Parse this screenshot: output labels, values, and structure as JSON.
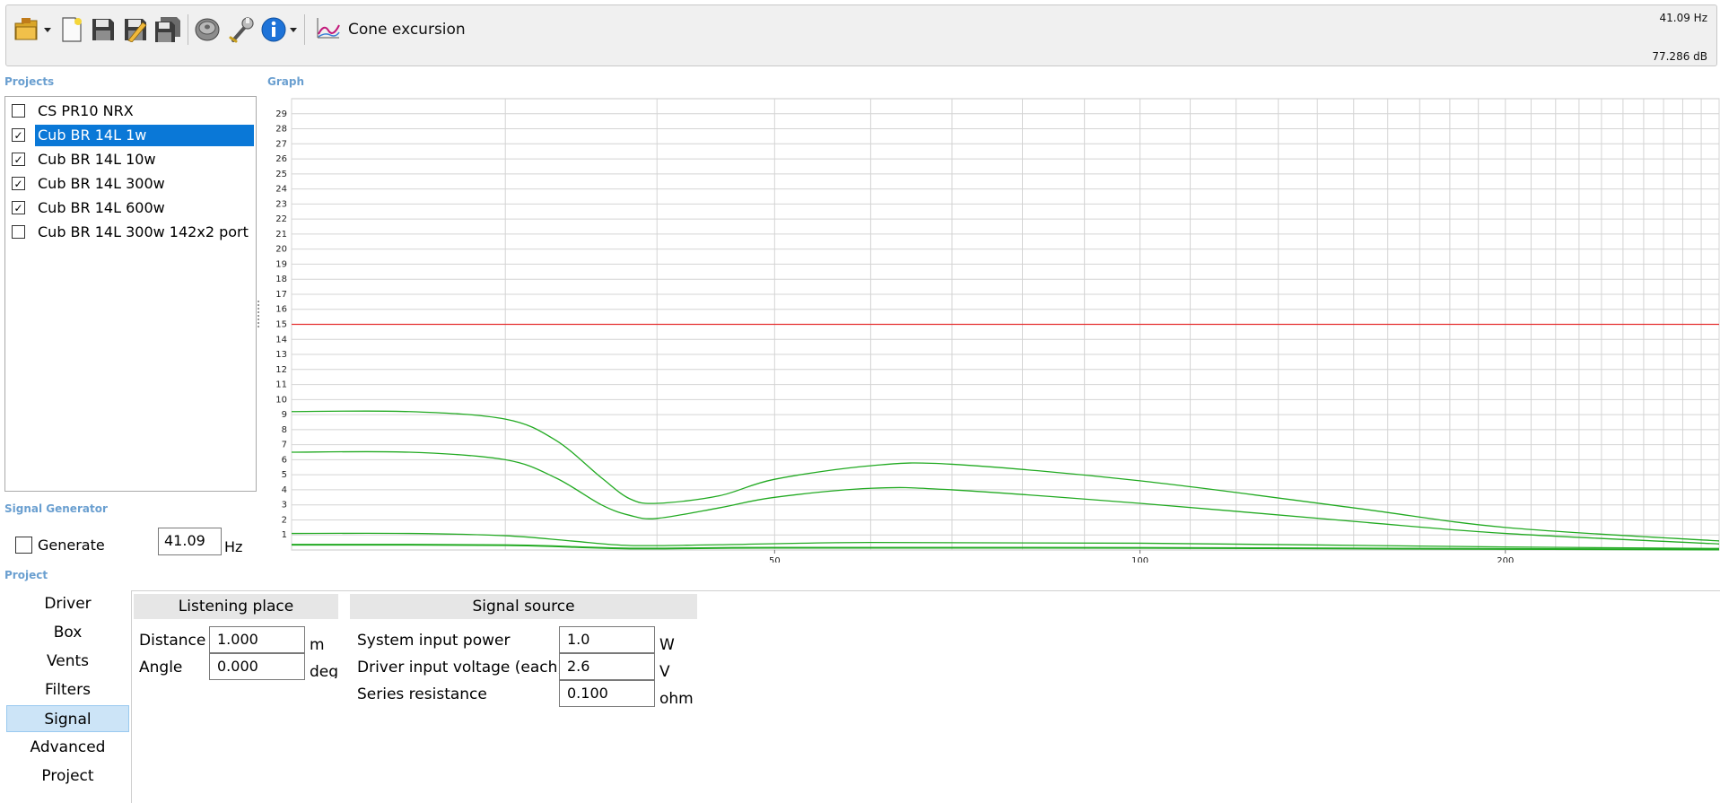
{
  "toolbar": {
    "icons": [
      "open-project-icon",
      "new-project-icon",
      "save-icon",
      "save-as-icon",
      "save-all-icon",
      "driver-icon",
      "tools-icon",
      "info-icon"
    ],
    "mode_label": "Cone excursion",
    "readout_frequency": "41.09 Hz",
    "readout_level": "77.286 dB"
  },
  "sections": {
    "projects": "Projects",
    "graph": "Graph",
    "signal_generator": "Signal Generator",
    "project": "Project"
  },
  "projects": [
    {
      "name": "CS PR10 NRX",
      "checked": false,
      "selected": false
    },
    {
      "name": "Cub BR 14L 1w",
      "checked": true,
      "selected": true
    },
    {
      "name": "Cub BR 14L 10w",
      "checked": true,
      "selected": false
    },
    {
      "name": "Cub BR 14L 300w",
      "checked": true,
      "selected": false
    },
    {
      "name": "Cub BR 14L 600w",
      "checked": true,
      "selected": false
    },
    {
      "name": "Cub BR 14L 300w 142x2 port",
      "checked": false,
      "selected": false
    }
  ],
  "signal_generator": {
    "generate_label": "Generate",
    "generate_checked": false,
    "frequency_value": "41.09",
    "frequency_unit": "Hz"
  },
  "nav": {
    "items": [
      "Driver",
      "Box",
      "Vents",
      "Filters",
      "Signal",
      "Advanced",
      "Project"
    ],
    "active": "Signal"
  },
  "listening_place": {
    "title": "Listening place",
    "distance_label": "Distance",
    "distance_value": "1.000",
    "distance_unit": "m",
    "angle_label": "Angle",
    "angle_value": "0.000",
    "angle_unit": "deg"
  },
  "signal_source": {
    "title": "Signal source",
    "power_label": "System input power",
    "power_value": "1.0",
    "power_unit": "W",
    "voltage_label": "Driver input voltage (each)",
    "voltage_value": "2.6",
    "voltage_unit": "V",
    "resistance_label": "Series resistance",
    "resistance_value": "0.100",
    "resistance_unit": "ohm"
  },
  "colors": {
    "curve": "#22aa22",
    "limit_line": "#e53030",
    "selection": "#0a78d7",
    "section_label": "#6a9fd0"
  },
  "chart_data": {
    "type": "line",
    "title": "",
    "xlabel": "",
    "ylabel": "",
    "x_scale": "log",
    "xlim": [
      20,
      300
    ],
    "ylim": [
      0,
      30
    ],
    "x_ticks": [
      50,
      100,
      200
    ],
    "y_ticks": [
      1,
      2,
      3,
      4,
      5,
      6,
      7,
      8,
      9,
      10,
      11,
      12,
      13,
      14,
      15,
      16,
      17,
      18,
      19,
      20,
      21,
      22,
      23,
      24,
      25,
      26,
      27,
      28,
      29
    ],
    "grid": true,
    "limit_line": 15,
    "series": [
      {
        "x": [
          20,
          25,
          30,
          33,
          36,
          38,
          40,
          45,
          50,
          60,
          70,
          100,
          150,
          200,
          300
        ],
        "y": [
          9.2,
          9.2,
          8.7,
          7.3,
          4.8,
          3.4,
          3.1,
          3.6,
          4.7,
          5.6,
          5.7,
          4.6,
          2.8,
          1.5,
          0.6
        ]
      },
      {
        "x": [
          20,
          25,
          30,
          33,
          36,
          38,
          40,
          45,
          50,
          60,
          70,
          100,
          150,
          200,
          300
        ],
        "y": [
          6.5,
          6.5,
          6.0,
          4.8,
          3.0,
          2.3,
          2.1,
          2.8,
          3.5,
          4.1,
          4.0,
          3.1,
          1.9,
          1.1,
          0.4
        ]
      },
      {
        "x": [
          20,
          25,
          30,
          34,
          38,
          45,
          60,
          100,
          200,
          300
        ],
        "y": [
          1.1,
          1.1,
          0.95,
          0.6,
          0.3,
          0.35,
          0.5,
          0.45,
          0.2,
          0.1
        ]
      },
      {
        "x": [
          20,
          30,
          38,
          50,
          100,
          200,
          300
        ],
        "y": [
          0.35,
          0.32,
          0.1,
          0.15,
          0.14,
          0.07,
          0.03
        ]
      }
    ]
  }
}
